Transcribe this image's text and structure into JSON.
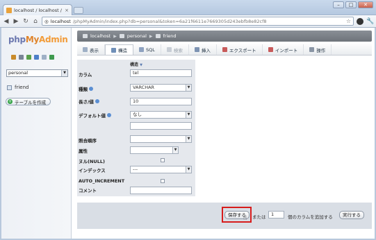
{
  "browser": {
    "tab_title": "localhost / localhost / perso",
    "tab_close": "×",
    "url_host": "localhost",
    "url_path": "/phpMyAdmin/index.php?db=personal&token=6a21f6611e7669305d243ebfb8e82cf8",
    "window_buttons": [
      "–",
      "□",
      "✕"
    ]
  },
  "sidebar": {
    "logo": {
      "php": "php",
      "my": "My",
      "admin": "Admin"
    },
    "db_select": "personal",
    "table_item": "friend",
    "create_table_label": "テーブルを作成"
  },
  "breadcrumb": [
    "localhost",
    "personal",
    "friend"
  ],
  "menu": {
    "tabs": [
      {
        "label": "表示",
        "state": "normal",
        "icon": "browse-icon"
      },
      {
        "label": "構造",
        "state": "active",
        "icon": "structure-icon"
      },
      {
        "label": "SQL",
        "state": "normal",
        "icon": "sql-icon"
      },
      {
        "label": "検索",
        "state": "disabled",
        "icon": "search-icon"
      },
      {
        "label": "挿入",
        "state": "normal",
        "icon": "insert-icon"
      },
      {
        "label": "エクスポート",
        "state": "normal",
        "icon": "export-icon"
      },
      {
        "label": "インポート",
        "state": "normal",
        "icon": "import-icon"
      },
      {
        "label": "操作",
        "state": "normal",
        "icon": "operations-icon"
      }
    ]
  },
  "form": {
    "column_header": "構造",
    "fields": {
      "column_label": "カラム",
      "column_value": "tel",
      "type_label": "種類",
      "type_value": "VARCHAR",
      "length_label": "長さ/値",
      "length_value": "10",
      "default_label": "デフォルト値",
      "default_value": "なし",
      "collation_label": "照合順序",
      "attribute_label": "属性",
      "null_label": "ヌル(NULL)",
      "index_label": "インデックス",
      "index_value": "---",
      "ai_label": "AUTO_INCREMENT",
      "comment_label": "コメント"
    }
  },
  "footer": {
    "save_label": "保存する",
    "or_text": "または",
    "add_count": "1",
    "add_text": "個のカラムを追加する",
    "run_label": "実行する"
  },
  "colors": {
    "highlight": "#d71c1c",
    "logo_php": "#6c78af",
    "logo_my": "#e0842b"
  }
}
